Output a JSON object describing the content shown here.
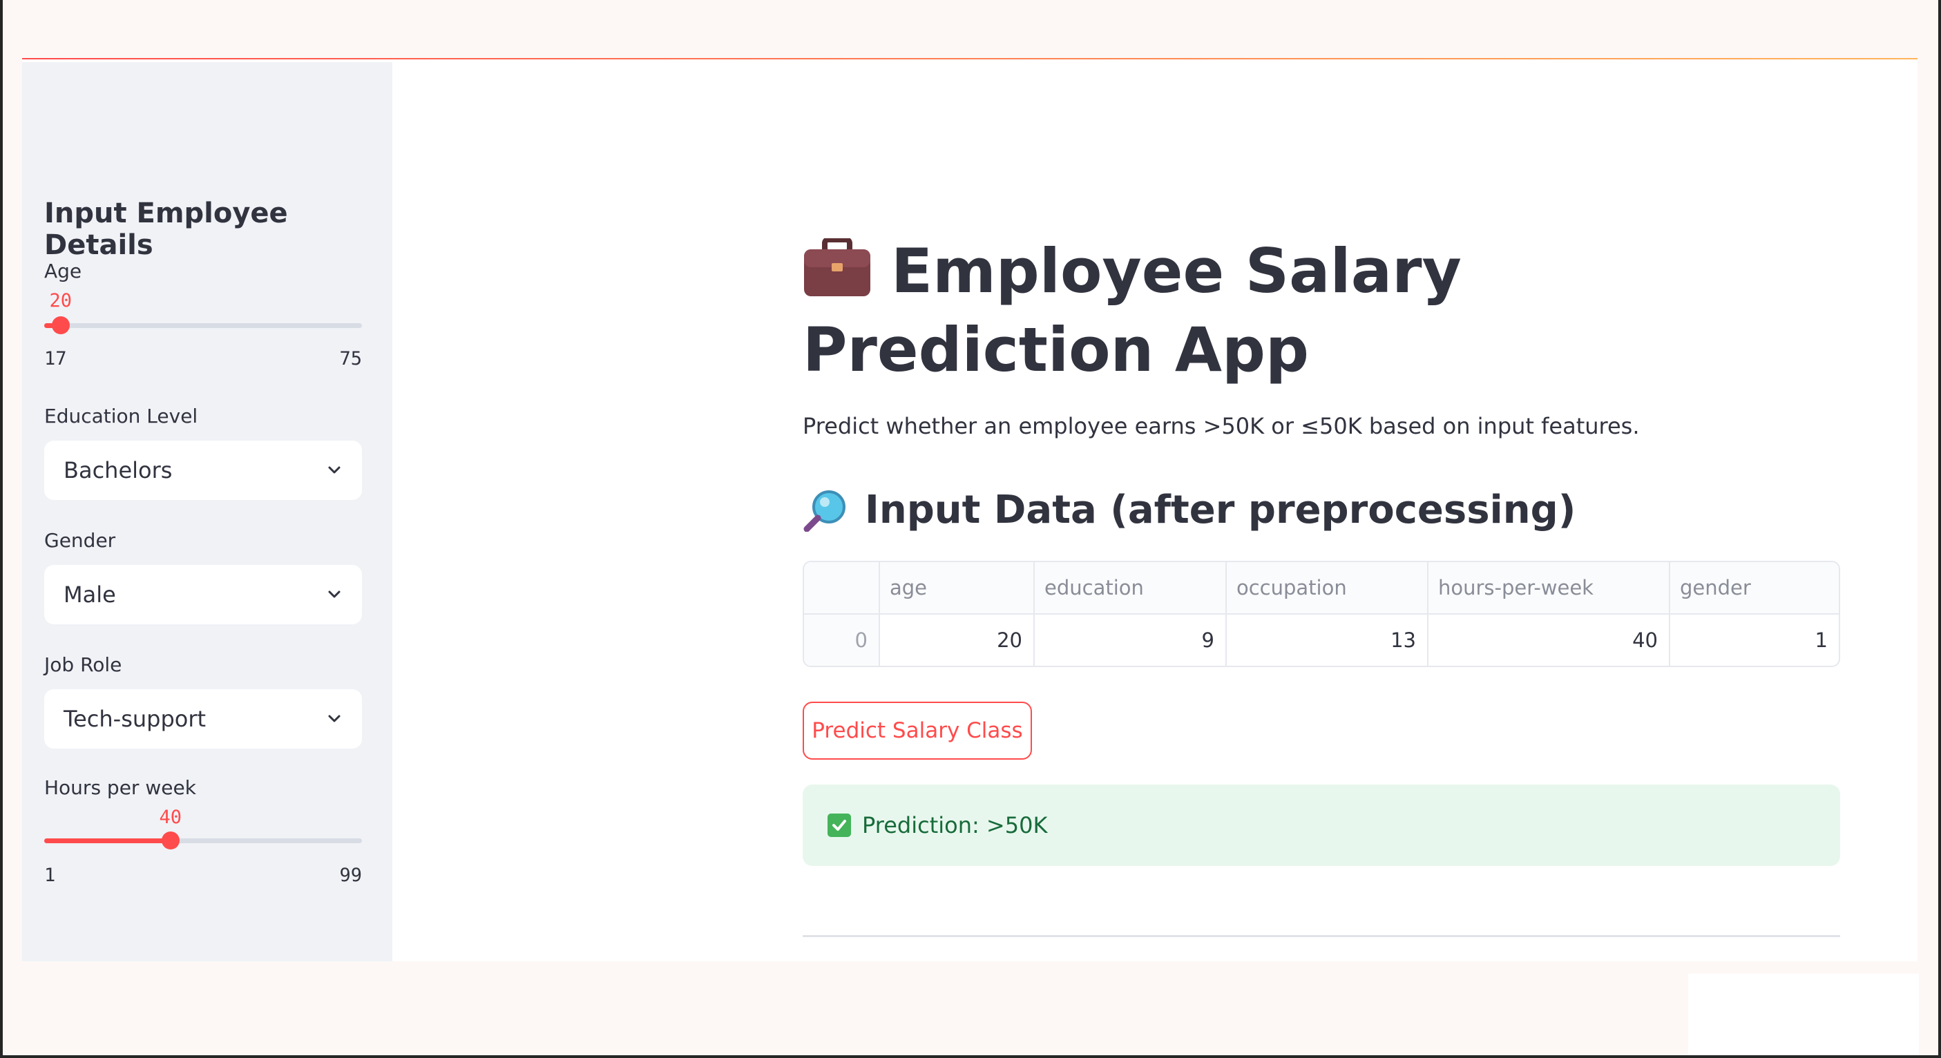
{
  "sidebar": {
    "heading": "Input Employee Details",
    "age": {
      "label": "Age",
      "value": 20,
      "value_text": "20",
      "min_text": "17",
      "max_text": "75",
      "fraction": 0.052
    },
    "education": {
      "label": "Education Level",
      "value": "Bachelors"
    },
    "gender": {
      "label": "Gender",
      "value": "Male"
    },
    "job_role": {
      "label": "Job Role",
      "value": "Tech-support"
    },
    "hours": {
      "label": "Hours per week",
      "value": 40,
      "value_text": "40",
      "min_text": "1",
      "max_text": "99",
      "fraction": 0.398
    }
  },
  "main": {
    "title": "Employee Salary Prediction App",
    "title_icon": "briefcase-icon",
    "subtitle": "Predict whether an employee earns >50K or ≤50K based on input features.",
    "section_title": "Input Data (after preprocessing)",
    "section_icon": "magnifier-icon",
    "table": {
      "columns": [
        "",
        "age",
        "education",
        "occupation",
        "hours-per-week",
        "gender"
      ],
      "rows": [
        [
          "0",
          "20",
          "9",
          "13",
          "40",
          "1"
        ]
      ]
    },
    "predict_button": "Predict Salary Class",
    "prediction": "Prediction: >50K"
  },
  "colors": {
    "accent": "#ff4b4b",
    "success_bg": "#e8f7ee",
    "success_text": "#176b3a",
    "sidebar_bg": "#f0f2f6"
  }
}
